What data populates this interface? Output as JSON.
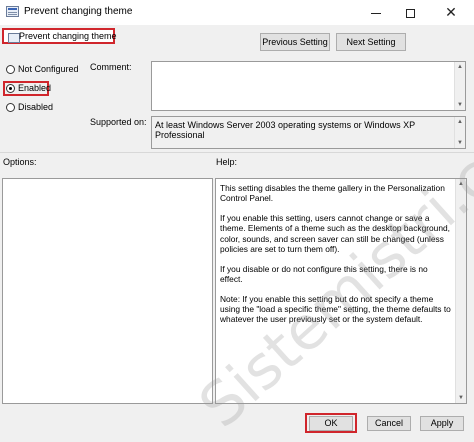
{
  "window": {
    "title": "Prevent changing theme",
    "minimize_icon": "minimize-icon",
    "maximize_icon": "maximize-icon",
    "close_icon": "close-icon"
  },
  "header": {
    "policy_name": "Prevent changing theme",
    "previous_label": "Previous Setting",
    "next_label": "Next Setting"
  },
  "state": {
    "options": [
      {
        "label": "Not Configured",
        "selected": false
      },
      {
        "label": "Enabled",
        "selected": true
      },
      {
        "label": "Disabled",
        "selected": false
      }
    ]
  },
  "comment": {
    "label": "Comment:",
    "value": ""
  },
  "supported": {
    "label": "Supported on:",
    "value": "At least Windows Server 2003 operating systems or Windows XP Professional"
  },
  "options_panel": {
    "label": "Options:"
  },
  "help": {
    "label": "Help:",
    "paragraphs": [
      "This setting disables the theme gallery in the Personalization Control Panel.",
      "If you enable this setting, users cannot change or save a theme. Elements of a theme such as the desktop background, color, sounds, and screen saver can still be changed (unless policies are set to turn them off).",
      "If you disable or do not configure this setting, there is no effect.",
      "Note: If you enable this setting but do not specify a theme using the \"load a specific theme\" setting, the theme defaults to whatever the user previously set or the system default."
    ]
  },
  "footer": {
    "ok_label": "OK",
    "cancel_label": "Cancel",
    "apply_label": "Apply"
  },
  "watermark": "Sistemistri.com",
  "colors": {
    "highlight_red": "#d0262c"
  }
}
